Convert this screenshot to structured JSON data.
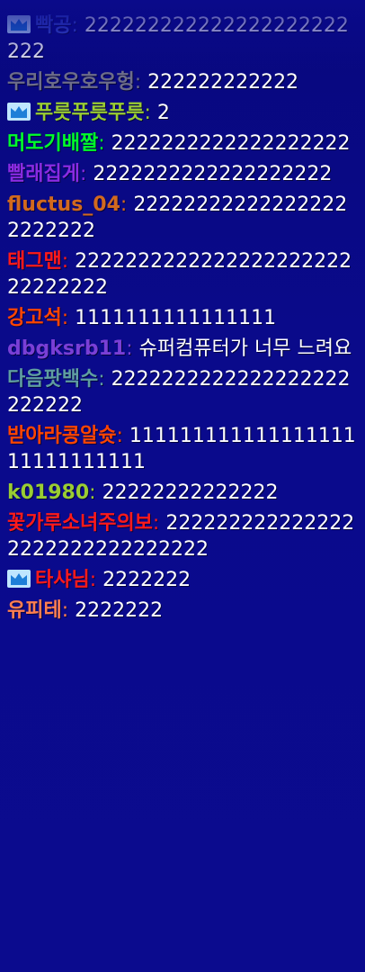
{
  "chat": {
    "messages": [
      {
        "nick": "빡공",
        "text": "222222222222222222222222",
        "color": "#3a4dcf",
        "badge": "crown-badge-icon"
      },
      {
        "nick": "우리호우호우헝",
        "text": "222222222222",
        "color": "#6d6d8a",
        "badge": null
      },
      {
        "nick": "푸릇푸릇푸릇",
        "text": "2",
        "color": "#9acd32",
        "badge": "crown-badge-icon"
      },
      {
        "nick": "머도기배짤",
        "text": "2222222222222222222",
        "color": "#00ff2a",
        "badge": null
      },
      {
        "nick": "빨래집게",
        "text": "2222222222222222222",
        "color": "#8a2be2",
        "badge": null
      },
      {
        "nick": "fluctus_04",
        "text": "222222222222222222222222",
        "color": "#d2691e",
        "badge": null
      },
      {
        "nick": "태그맨",
        "text": "222222222222222222222222222222",
        "color": "#ff1a1a",
        "badge": null
      },
      {
        "nick": "강고석",
        "text": "1111111111111111",
        "color": "#ff4500",
        "badge": null
      },
      {
        "nick": "dbgksrb11",
        "text": "슈퍼컴퓨터가 너무 느려요",
        "color": "#7a3fd6",
        "badge": null
      },
      {
        "nick": "다음팟백수",
        "text": "2222222222222222222222222",
        "color": "#5f9ea0",
        "badge": null
      },
      {
        "nick": "받아라콩알슛",
        "text": "11111111111111111111111111111",
        "color": "#ff4500",
        "badge": null
      },
      {
        "nick": "k01980",
        "text": "22222222222222",
        "color": "#9acd32",
        "badge": null
      },
      {
        "nick": "꽃가루소녀주의보",
        "text": "2222222222222222222222222222222",
        "color": "#ff1a1a",
        "badge": null
      },
      {
        "nick": "타샤님",
        "text": "2222222",
        "color": "#ff1a1a",
        "badge": "crown-badge-icon"
      },
      {
        "nick": "유피테",
        "text": "2222222",
        "color": "#ff7f50",
        "badge": null
      }
    ]
  }
}
